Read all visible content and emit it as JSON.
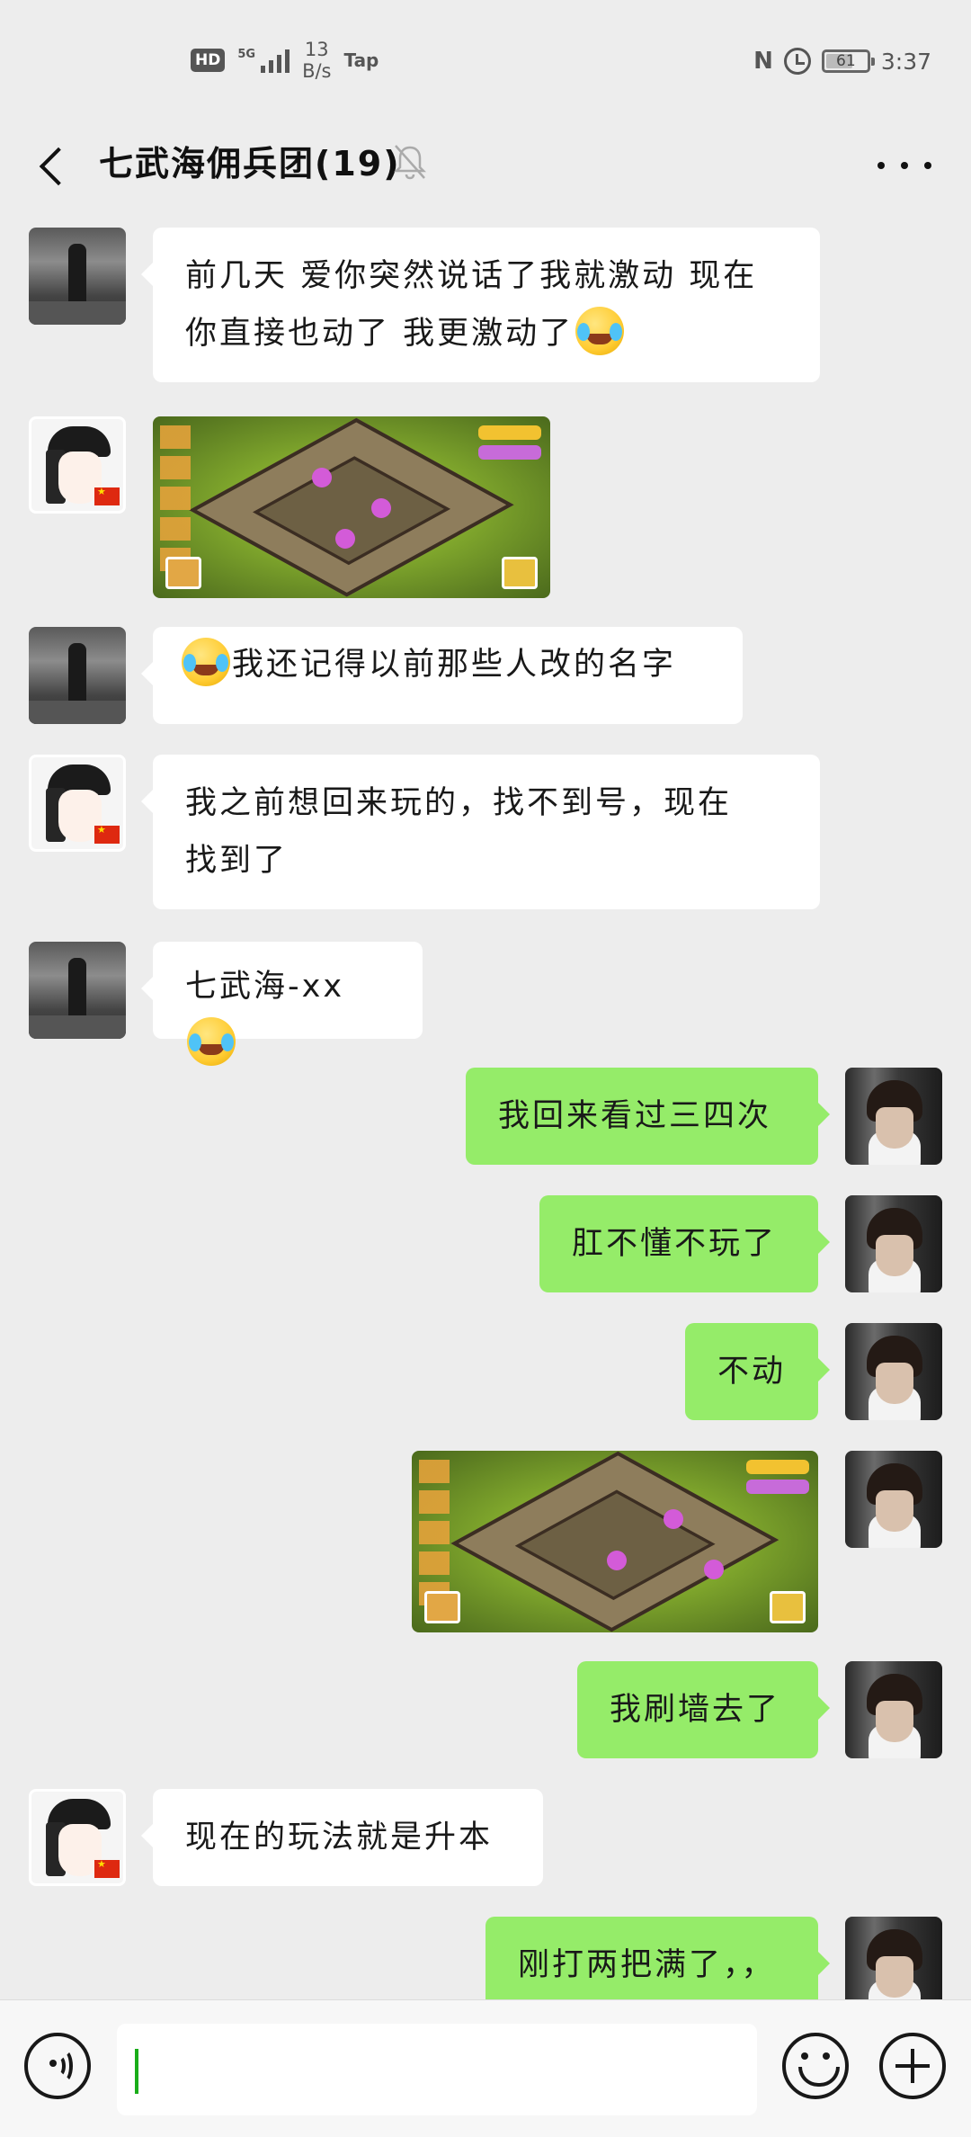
{
  "status_bar": {
    "hd": "HD",
    "network": "5G",
    "speed_value": "13",
    "speed_unit": "B/s",
    "app_indicator": "Tap",
    "nfc": "N",
    "battery": "61",
    "time": "3:37"
  },
  "header": {
    "title": "七武海佣兵团(19)",
    "back_icon": "chevron-left-icon",
    "mute_icon": "bell-off-icon",
    "more_icon": "more-dots-icon"
  },
  "messages": [
    {
      "side": "left",
      "avatar": "street-photo",
      "type": "text",
      "line1": "前几天 爱你突然说话了我就激动  现在",
      "line2": "你直接也动了  我更激动了"
    },
    {
      "side": "left",
      "avatar": "anime-cap",
      "type": "image",
      "alt": "game-screenshot"
    },
    {
      "side": "left",
      "avatar": "street-photo",
      "type": "text",
      "text": "我还记得以前那些人改的名字"
    },
    {
      "side": "left",
      "avatar": "anime-cap",
      "type": "text",
      "line1": "我之前想回来玩的，找不到号，现在",
      "line2": "找到了"
    },
    {
      "side": "left",
      "avatar": "street-photo",
      "type": "text",
      "text": "七武海-xx"
    },
    {
      "side": "right",
      "avatar": "boy-photo",
      "type": "text",
      "text": "我回来看过三四次"
    },
    {
      "side": "right",
      "avatar": "boy-photo",
      "type": "text",
      "text": "肛不懂不玩了"
    },
    {
      "side": "right",
      "avatar": "boy-photo",
      "type": "text",
      "text": "不动"
    },
    {
      "side": "right",
      "avatar": "boy-photo",
      "type": "image",
      "alt": "game-screenshot"
    },
    {
      "side": "right",
      "avatar": "boy-photo",
      "type": "text",
      "text": "我刷墙去了"
    },
    {
      "side": "left",
      "avatar": "anime-cap",
      "type": "text",
      "text": "现在的玩法就是升本"
    },
    {
      "side": "right",
      "avatar": "boy-photo",
      "type": "text",
      "text": "刚打两把满了，，"
    }
  ],
  "input_bar": {
    "voice_icon": "voice-icon",
    "text_value": "",
    "emoji_icon": "emoji-icon",
    "plus_icon": "plus-icon"
  },
  "colors": {
    "background": "#ededed",
    "incoming_bubble": "#ffffff",
    "outgoing_bubble": "#95ec69",
    "caret": "#1aad19"
  }
}
